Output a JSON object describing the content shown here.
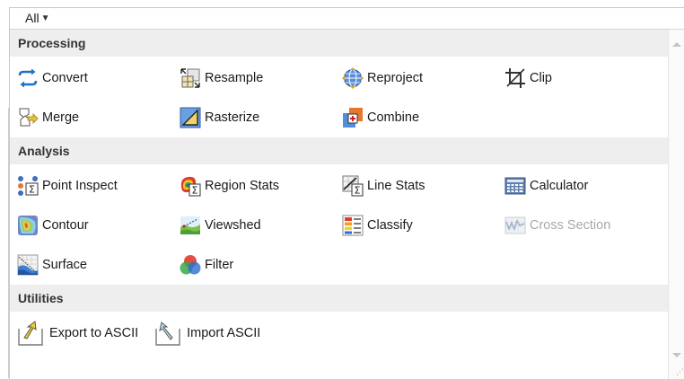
{
  "filter": {
    "label": "All"
  },
  "sections": {
    "processing": {
      "title": "Processing",
      "rows": [
        [
          "Convert",
          "Resample",
          "Reproject",
          "Clip"
        ],
        [
          "Merge",
          "Rasterize",
          "Combine"
        ]
      ]
    },
    "analysis": {
      "title": "Analysis",
      "rows": [
        [
          "Point Inspect",
          "Region Stats",
          "Line Stats",
          "Calculator"
        ],
        [
          "Contour",
          "Viewshed",
          "Classify",
          "Cross Section"
        ],
        [
          "Surface",
          "Filter"
        ]
      ],
      "disabled": [
        "Cross Section"
      ]
    },
    "utilities": {
      "title": "Utilities",
      "items": [
        "Export to ASCII",
        "Import ASCII"
      ]
    }
  },
  "icons": {
    "Convert": "convert-icon",
    "Resample": "resample-icon",
    "Reproject": "reproject-icon",
    "Clip": "clip-icon",
    "Merge": "merge-icon",
    "Rasterize": "rasterize-icon",
    "Combine": "combine-icon",
    "Point Inspect": "point-inspect-icon",
    "Region Stats": "region-stats-icon",
    "Line Stats": "line-stats-icon",
    "Calculator": "calculator-icon",
    "Contour": "contour-icon",
    "Viewshed": "viewshed-icon",
    "Classify": "classify-icon",
    "Cross Section": "cross-section-icon",
    "Surface": "surface-icon",
    "Filter": "filter-icon",
    "Export to ASCII": "export-ascii-icon",
    "Import ASCII": "import-ascii-icon"
  },
  "colors": {
    "accent_blue": "#1f6fc5",
    "header_bg": "#eeeeee",
    "disabled_text": "#a8a8a8"
  }
}
